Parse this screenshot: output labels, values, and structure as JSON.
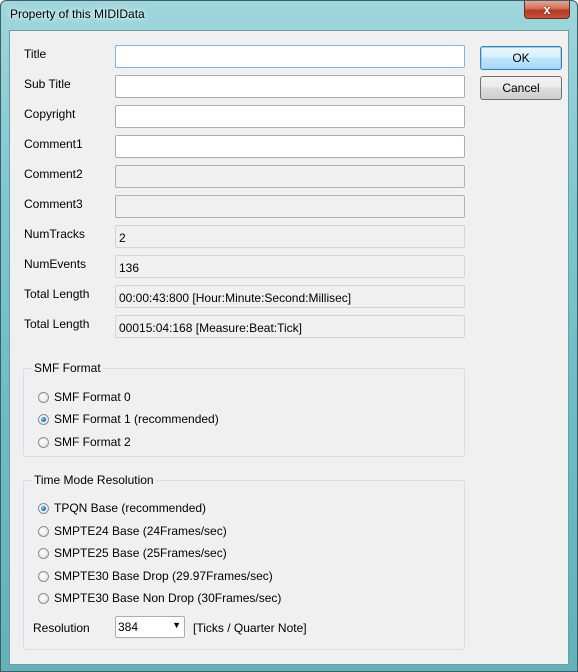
{
  "window": {
    "title": "Property of this MIDIData",
    "close_label": "x"
  },
  "fields": [
    {
      "label": "Title",
      "value": "",
      "state": "focus"
    },
    {
      "label": "Sub Title",
      "value": "",
      "state": "editable"
    },
    {
      "label": "Copyright",
      "value": "",
      "state": "editable"
    },
    {
      "label": "Comment1",
      "value": "",
      "state": "editable"
    },
    {
      "label": "Comment2",
      "value": "",
      "state": "disabled"
    },
    {
      "label": "Comment3",
      "value": "",
      "state": "disabled"
    },
    {
      "label": "NumTracks",
      "value": "2",
      "state": "readonly"
    },
    {
      "label": "NumEvents",
      "value": "136",
      "state": "readonly"
    },
    {
      "label": "Total Length",
      "value": "00:00:43:800 [Hour:Minute:Second:Millisec]",
      "state": "readonly"
    },
    {
      "label": "Total Length",
      "value": "00015:04:168 [Measure:Beat:Tick]",
      "state": "readonly"
    }
  ],
  "buttons": {
    "ok": "OK",
    "cancel": "Cancel"
  },
  "smf_format": {
    "title": "SMF Format",
    "options": [
      {
        "label": "SMF Format 0",
        "checked": false
      },
      {
        "label": "SMF Format 1 (recommended)",
        "checked": true
      },
      {
        "label": "SMF Format 2",
        "checked": false
      }
    ]
  },
  "time_mode": {
    "title": "Time Mode Resolution",
    "options": [
      {
        "label": "TPQN Base (recommended)",
        "checked": true
      },
      {
        "label": "SMPTE24 Base (24Frames/sec)",
        "checked": false
      },
      {
        "label": "SMPTE25 Base (25Frames/sec)",
        "checked": false
      },
      {
        "label": "SMPTE30 Base Drop (29.97Frames/sec)",
        "checked": false
      },
      {
        "label": "SMPTE30 Base Non Drop (30Frames/sec)",
        "checked": false
      }
    ],
    "resolution_label": "Resolution",
    "resolution_value": "384",
    "resolution_unit": "[Ticks / Quarter Note]"
  }
}
